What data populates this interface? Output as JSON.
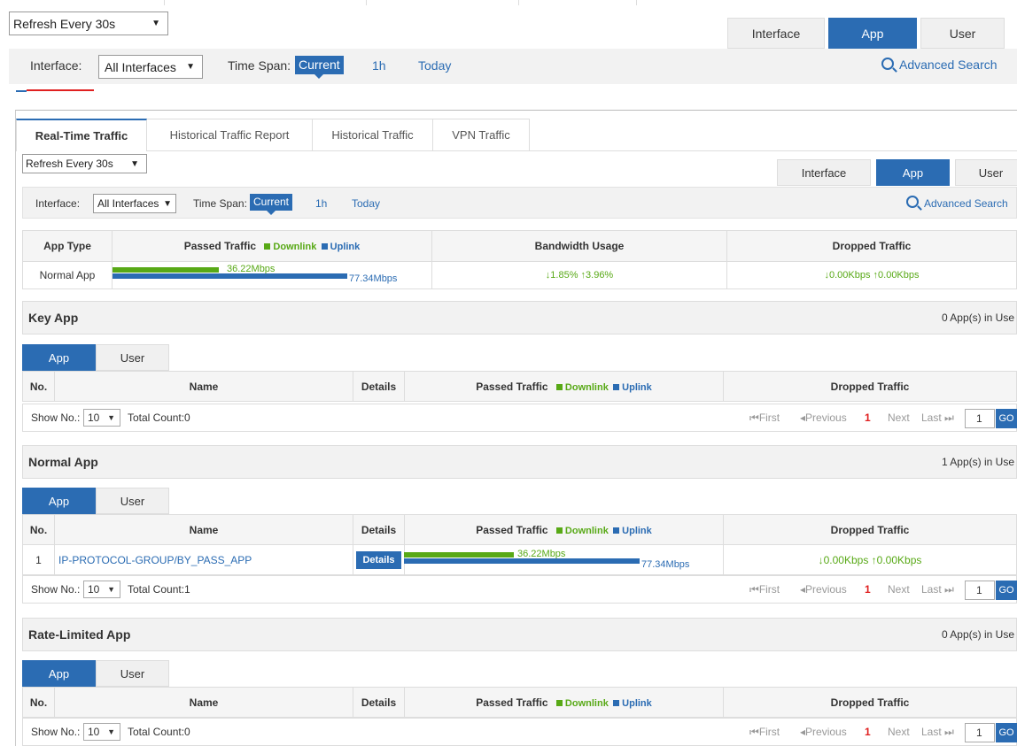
{
  "top": {
    "refresh_select": "Refresh Every 30s",
    "view_tabs": [
      "Interface",
      "App",
      "User"
    ],
    "active_view": "App",
    "interface_label": "Interface:",
    "interface_select": "All Interfaces",
    "timespan_label": "Time Span:",
    "timespan_options": [
      "Current",
      "1h",
      "Today"
    ],
    "advanced_search": "Advanced Search"
  },
  "main_tabs": [
    "Real-Time Traffic",
    "Historical Traffic Report",
    "Historical Traffic",
    "VPN Traffic"
  ],
  "inner": {
    "refresh_select": "Refresh Every 30s",
    "view_tabs": [
      "Interface",
      "App",
      "User"
    ],
    "interface_label": "Interface:",
    "interface_select": "All Interfaces",
    "timespan_label": "Time Span:",
    "timespan_options": [
      "Current",
      "1h",
      "Today"
    ],
    "advanced_search": "Advanced Search"
  },
  "summary": {
    "headers": {
      "app_type": "App Type",
      "passed_traffic": "Passed Traffic",
      "downlink": "Downlink",
      "uplink": "Uplink",
      "bandwidth": "Bandwidth Usage",
      "dropped": "Dropped Traffic"
    },
    "row": {
      "app_type": "Normal App",
      "downlink_value": "36.22Mbps",
      "uplink_value": "77.34Mbps",
      "bandwidth": "↓1.85% ↑3.96%",
      "dropped": "↓0.00Kbps ↑0.00Kbps"
    }
  },
  "columns": {
    "no": "No.",
    "name": "Name",
    "details": "Details",
    "passed_traffic": "Passed Traffic",
    "downlink": "Downlink",
    "uplink": "Uplink",
    "dropped": "Dropped Traffic"
  },
  "sub_tabs": [
    "App",
    "User"
  ],
  "pager": {
    "show_no_label": "Show No.:",
    "page_size": "10",
    "first": "First",
    "previous": "Previous",
    "current_page": "1",
    "next": "Next",
    "last": "Last",
    "page_input": "1",
    "go": "GO"
  },
  "sections": [
    {
      "title": "Key App",
      "count": "0 App(s) in Use",
      "total": "Total Count:0"
    },
    {
      "title": "Normal App",
      "count": "1 App(s) in Use",
      "total": "Total Count:1",
      "row": {
        "no": "1",
        "name": "IP-PROTOCOL-GROUP/BY_PASS_APP",
        "details": "Details",
        "downlink_value": "36.22Mbps",
        "uplink_value": "77.34Mbps",
        "dropped": "↓0.00Kbps ↑0.00Kbps"
      }
    },
    {
      "title": "Rate-Limited App",
      "count": "0 App(s) in Use",
      "total": "Total Count:0"
    }
  ],
  "colors": {
    "accent": "#2b6cb3",
    "downlink": "#58a916",
    "uplink": "#2b6cb3",
    "indicator": "#e02020"
  }
}
